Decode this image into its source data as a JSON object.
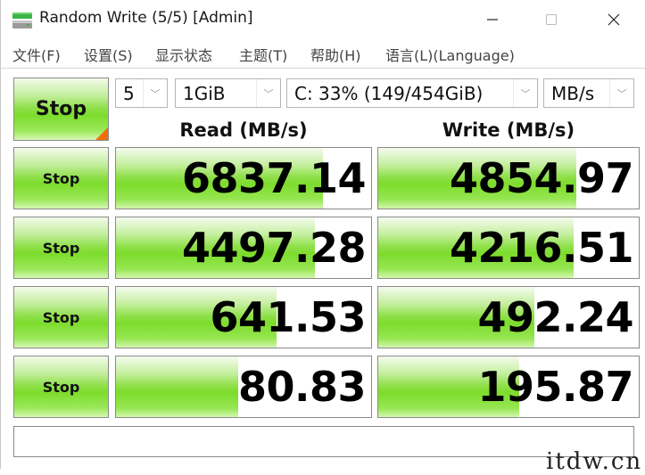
{
  "window": {
    "title": "Random Write (5/5) [Admin]",
    "app_icon": "disk-drive-icon",
    "controls": {
      "minimize": "—",
      "maximize": "☐",
      "close": "✕"
    }
  },
  "menu": [
    {
      "label": "文件(F)"
    },
    {
      "label": "设置(S)"
    },
    {
      "label": "显示状态"
    },
    {
      "label": "主题(T)"
    },
    {
      "label": "帮助(H)"
    },
    {
      "label": "语言(L)(Language)"
    }
  ],
  "controls": {
    "main_button": "Stop",
    "test_count": "5",
    "test_size": "1GiB",
    "drive": "C: 33% (149/454GiB)",
    "unit": "MB/s"
  },
  "columns": {
    "read_header": "Read (MB/s)",
    "write_header": "Write (MB/s)"
  },
  "rows": [
    {
      "button": "Stop",
      "read": "6837.14",
      "write": "4854.97",
      "read_fill": 0.81,
      "write_fill": 0.76
    },
    {
      "button": "Stop",
      "read": "4497.28",
      "write": "4216.51",
      "read_fill": 0.78,
      "write_fill": 0.75
    },
    {
      "button": "Stop",
      "read": "641.53",
      "write": "492.24",
      "read_fill": 0.63,
      "write_fill": 0.6
    },
    {
      "button": "Stop",
      "read": "80.83",
      "write": "195.87",
      "read_fill": 0.48,
      "write_fill": 0.54
    }
  ],
  "comment": "",
  "watermark": "itdw.cn",
  "colors": {
    "bar_green": "#7ddc2c",
    "corner_orange": "#f07010",
    "border": "#8a8a8a"
  }
}
